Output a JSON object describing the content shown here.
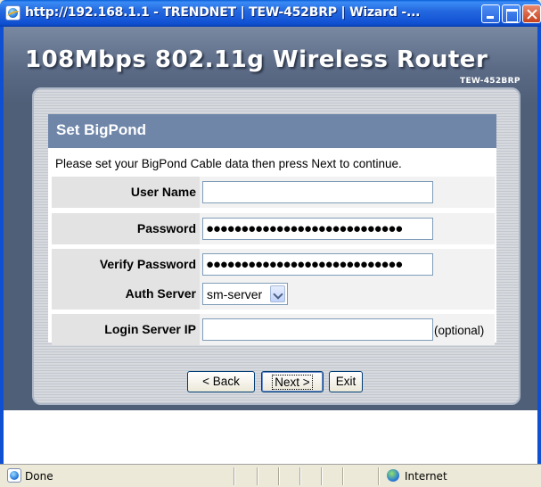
{
  "window": {
    "title": "http://192.168.1.1 - TRENDNET | TEW-452BRP | Wizard -..."
  },
  "banner": {
    "title": "108Mbps 802.11g Wireless Router",
    "model": "TEW-452BRP"
  },
  "section": {
    "title": "Set BigPond",
    "instructions": "Please set your BigPond Cable data then press Next to continue."
  },
  "form": {
    "user_name_label": "User Name",
    "user_name_value": "",
    "password_label": "Password",
    "password_value": "●●●●●●●●●●●●●●●●●●●●●●●●●●●●",
    "verify_password_label": "Verify Password",
    "verify_password_value": "●●●●●●●●●●●●●●●●●●●●●●●●●●●●",
    "auth_server_label": "Auth Server",
    "auth_server_value": "sm-server",
    "login_server_ip_label": "Login Server IP",
    "login_server_ip_value": "",
    "optional_note": "(optional)"
  },
  "buttons": {
    "back": "< Back",
    "next": "Next >",
    "exit": "Exit"
  },
  "status": {
    "text": "Done",
    "zone": "Internet"
  }
}
